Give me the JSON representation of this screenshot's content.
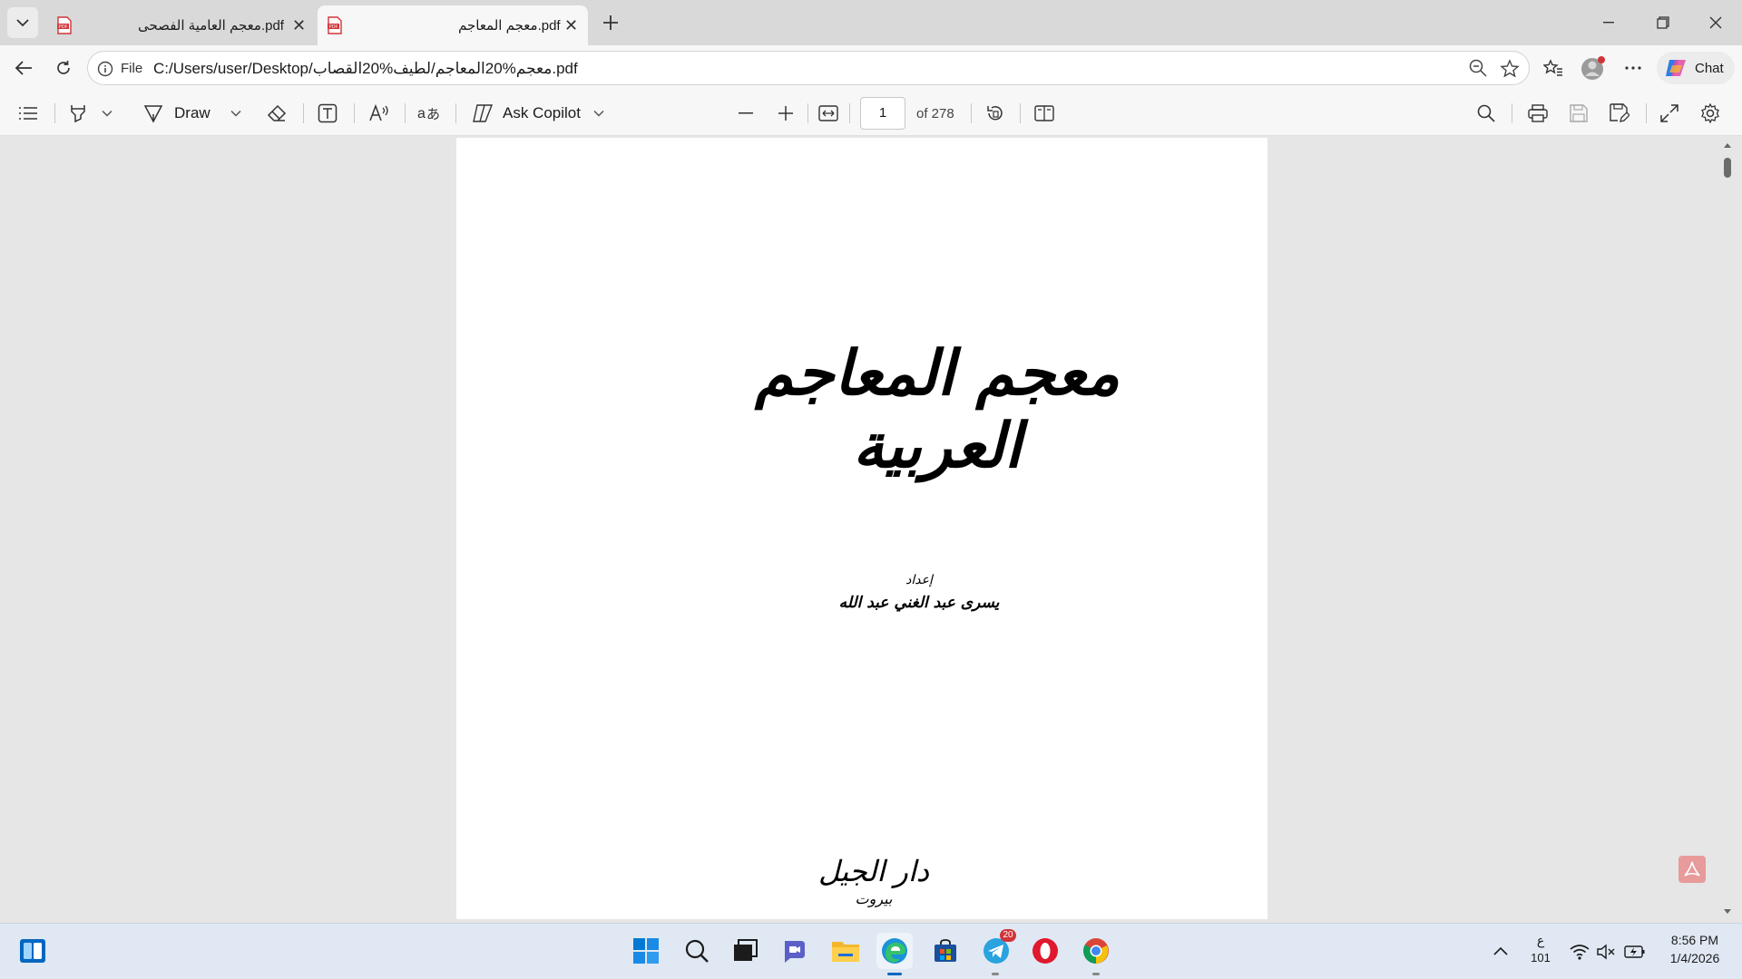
{
  "browser": {
    "tabs": [
      {
        "title": "معجم العامية الفصحى.pdf",
        "active": false
      },
      {
        "title": "معجم المعاجم.pdf",
        "active": true
      }
    ],
    "new_tab_label": "+",
    "address": {
      "scheme_label": "File",
      "url": "C:/Users/user/Desktop/معجم%20المعاجم/لطيف%20القصاب.pdf"
    },
    "chat_label": "Chat"
  },
  "pdf_toolbar": {
    "draw_label": "Draw",
    "ask_copilot_label": "Ask Copilot",
    "page_number": "1",
    "page_count_label": "of 278"
  },
  "document": {
    "title": "معجم المعاجم العربية",
    "prepared_by_label": "إعداد",
    "author": "يسرى عبد الغني عبد الله",
    "publisher": "دار الجيل",
    "city": "بيروت"
  },
  "taskbar": {
    "telegram_badge": "20",
    "input_lang_top": "ع",
    "input_lang_bottom": "101",
    "time": "8:56 PM",
    "date": "1/4/2026"
  },
  "colors": {
    "tabstrip": "#d9d9d9",
    "toolbar": "#f7f7f7",
    "viewer_bg": "#e6e6e6",
    "taskbar": "#dfe8f3",
    "pdf_red": "#d13438",
    "accent": "#0067c0"
  }
}
